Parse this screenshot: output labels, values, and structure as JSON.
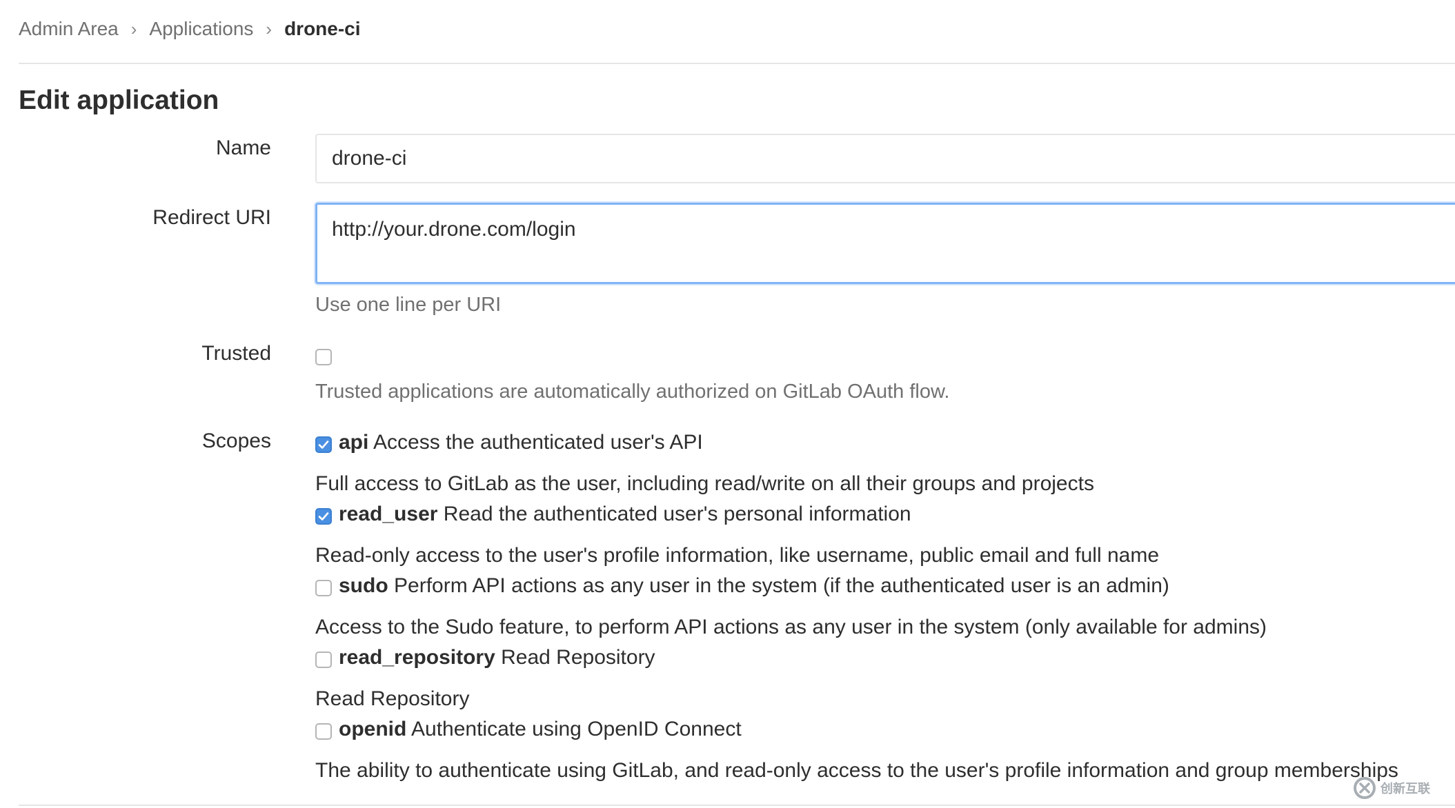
{
  "breadcrumb": {
    "items": [
      "Admin Area",
      "Applications"
    ],
    "current": "drone-ci",
    "separator": "›"
  },
  "page_title": "Edit application",
  "form": {
    "name": {
      "label": "Name",
      "value": "drone-ci"
    },
    "redirect_uri": {
      "label": "Redirect URI",
      "value": "http://your.drone.com/login",
      "help": "Use one line per URI"
    },
    "trusted": {
      "label": "Trusted",
      "checked": false,
      "help": "Trusted applications are automatically authorized on GitLab OAuth flow."
    },
    "scopes": {
      "label": "Scopes",
      "items": [
        {
          "key": "api",
          "title": "Access the authenticated user's API",
          "checked": true,
          "description": "Full access to GitLab as the user, including read/write on all their groups and projects"
        },
        {
          "key": "read_user",
          "title": "Read the authenticated user's personal information",
          "checked": true,
          "description": "Read-only access to the user's profile information, like username, public email and full name"
        },
        {
          "key": "sudo",
          "title": "Perform API actions as any user in the system (if the authenticated user is an admin)",
          "checked": false,
          "description": "Access to the Sudo feature, to perform API actions as any user in the system (only available for admins)"
        },
        {
          "key": "read_repository",
          "title": "Read Repository",
          "checked": false,
          "description": "Read Repository"
        },
        {
          "key": "openid",
          "title": "Authenticate using OpenID Connect",
          "checked": false,
          "description": "The ability to authenticate using GitLab, and read-only access to the user's profile information and group memberships"
        }
      ]
    }
  },
  "watermark": {
    "text": "创新互联"
  },
  "colors": {
    "accent": "#4a90e2",
    "focus_border": "#7fb3f5",
    "text": "#2e2e2e",
    "muted": "#707070",
    "border": "#e5e5e5"
  }
}
